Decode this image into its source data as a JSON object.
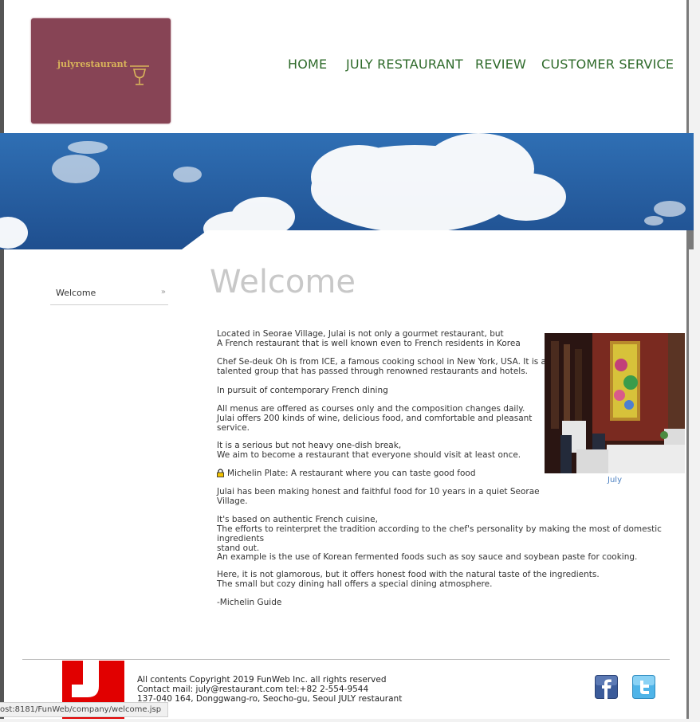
{
  "logo": {
    "text": "julyrestaurant",
    "color": "#874455",
    "text_color": "#d9b45a",
    "icon": "wine-glass-icon"
  },
  "nav": {
    "items": [
      {
        "label": "HOME"
      },
      {
        "label": "JULY RESTAURANT"
      },
      {
        "label": "REVIEW"
      },
      {
        "label": "CUSTOMER SERVICE"
      }
    ],
    "color": "#2e6a2a"
  },
  "sidebar": {
    "items": [
      {
        "label": "Welcome",
        "arrow": "»"
      }
    ]
  },
  "main": {
    "title": "Welcome",
    "paragraphs": [
      " Located in Seorae Village, Julai is not only a gourmet restaurant, but\n A French restaurant that is well known even to French residents in Korea",
      "Chef Se-deuk Oh is from ICE, a famous cooking school in New York, USA. It is a\ntalented group that has passed through renowned restaurants and hotels.",
      "In pursuit of contemporary French dining",
      "All menus are offered as courses only and the composition changes daily.\nJulai offers 200 kinds of wine, delicious food, and comfortable and pleasant\nservice.",
      "It is a serious but not heavy one-dish break,\nWe aim to become a restaurant that everyone should visit at least once.",
      "Michelin Plate: A restaurant where you can taste good food",
      "Julai has been making honest and faithful food for 10 years in a quiet Seorae\nVillage.",
      "It's based on authentic French cuisine,\nThe efforts to reinterpret the tradition according to the chef's personality by making the most of domestic ingredients\nstand out.",
      "An example is the use of Korean fermented foods such as soy sauce and soybean paste for cooking.",
      "Here, it is not glamorous, but it offers honest food with the natural taste of the ingredients.\nThe small but cozy dining hall offers a special dining atmosphere.",
      "-Michelin Guide"
    ],
    "photo_caption": "July",
    "michelin_icon": "lock-icon"
  },
  "footer": {
    "lines": [
      "All contents Copyright 2019 FunWeb Inc. all rights reserved",
      "Contact mail: july@restaurant.com tel:+82 2-554-9544",
      "137-040 164, Donggwang-ro, Seocho-gu, Seoul JULY restaurant"
    ],
    "logo_letter": "J",
    "logo_color": "#e10000",
    "social": [
      "facebook-icon",
      "twitter-icon"
    ]
  },
  "statusbar": {
    "url": "ost:8181/FunWeb/company/welcome.jsp"
  }
}
